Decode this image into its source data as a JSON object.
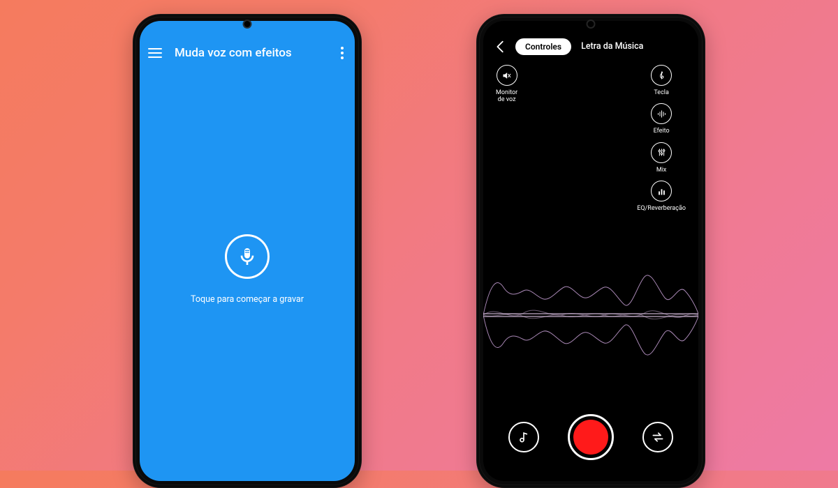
{
  "leftPhone": {
    "appTitle": "Muda voz com efeitos",
    "recordPrompt": "Toque para começar a gravar"
  },
  "rightPhone": {
    "tabs": {
      "controls": "Controles",
      "lyrics": "Letra da Música"
    },
    "tools": {
      "voiceMonitor": "Monitor\nde voz",
      "key": "Tecla",
      "effect": "Efeito",
      "mix": "Mix",
      "eqReverb": "EQ/Reverberação"
    }
  }
}
